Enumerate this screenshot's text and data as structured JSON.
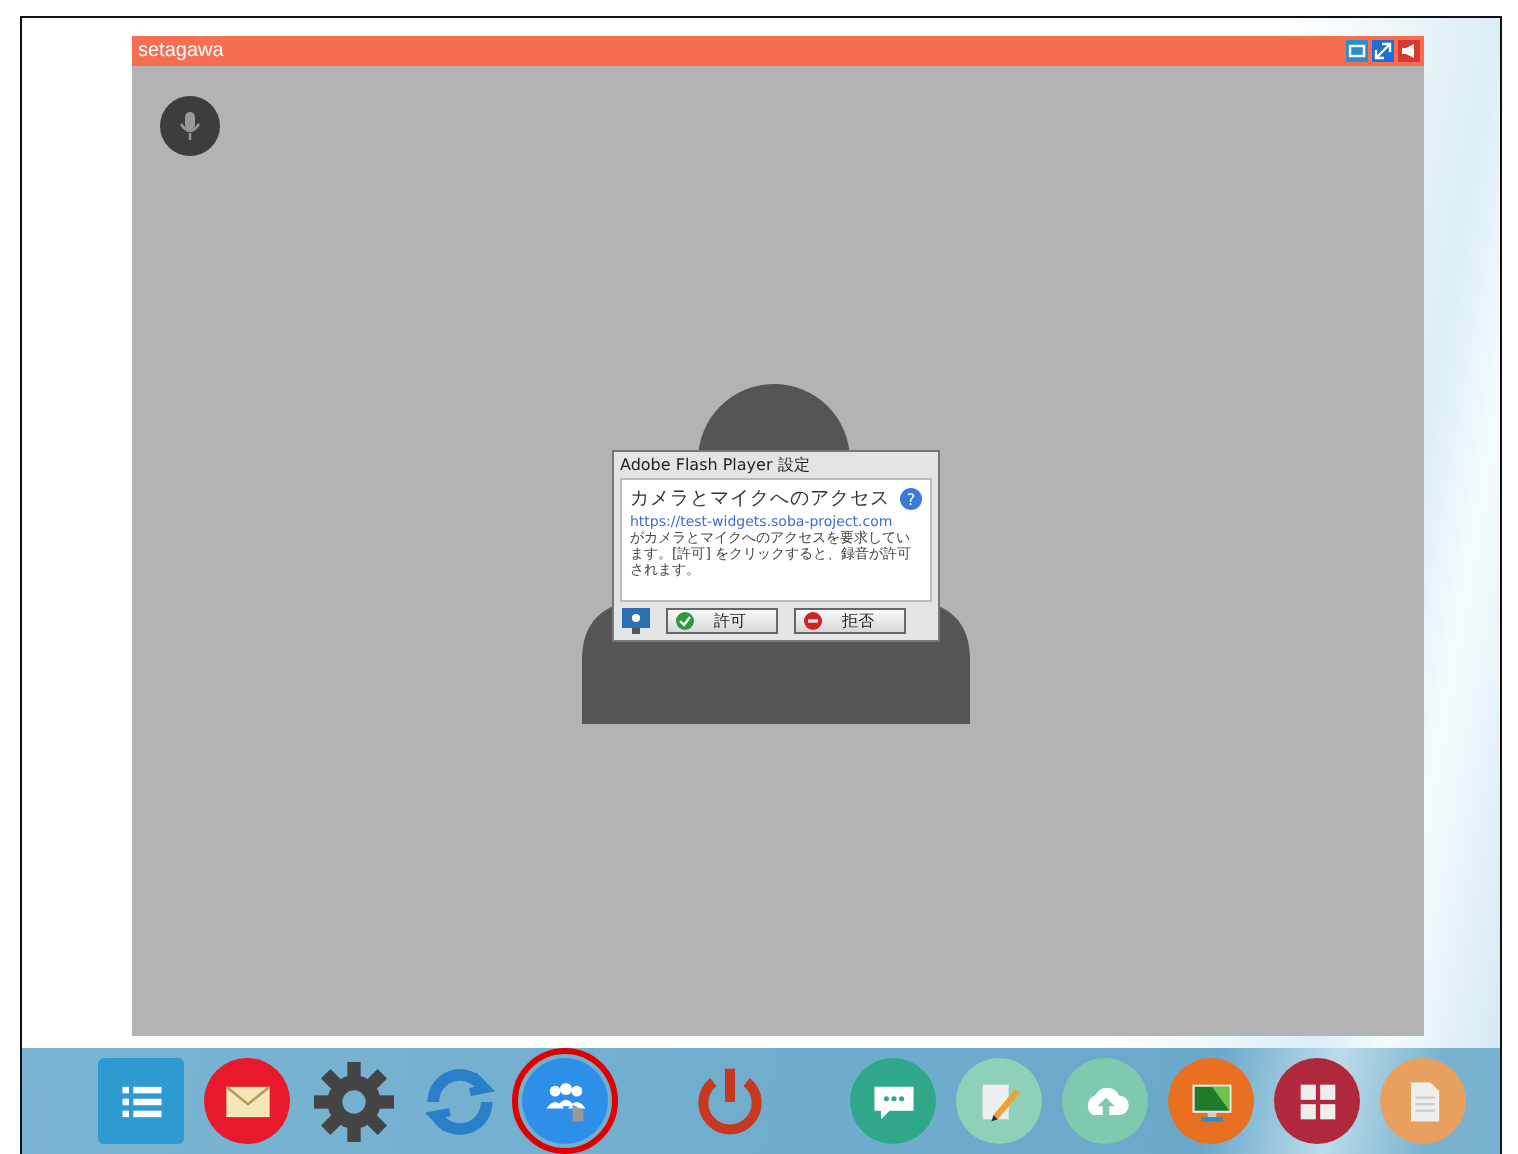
{
  "window": {
    "title": "setagawa"
  },
  "dialog": {
    "title": "Adobe Flash Player 設定",
    "heading": "カメラとマイクへのアクセス",
    "help": "?",
    "url": "https://test-widgets.soba-project.com",
    "message": "がカメラとマイクへのアクセスを要求しています。[許可] をクリックすると、録音が許可されます。",
    "buttons": [
      {
        "kind": "allow",
        "label": "許可"
      },
      {
        "kind": "deny",
        "label": "拒否"
      }
    ]
  },
  "toolbar": [
    {
      "kind": "list",
      "selected": false
    },
    {
      "kind": "mail",
      "selected": false
    },
    {
      "kind": "settings",
      "selected": false
    },
    {
      "kind": "sync",
      "selected": false
    },
    {
      "kind": "people",
      "selected": true
    },
    {
      "kind": "power",
      "selected": false
    },
    {
      "kind": "chat",
      "selected": false
    },
    {
      "kind": "edit",
      "selected": false
    },
    {
      "kind": "upload",
      "selected": false
    },
    {
      "kind": "screen",
      "selected": false
    },
    {
      "kind": "grid",
      "selected": false
    },
    {
      "kind": "document",
      "selected": false
    }
  ]
}
